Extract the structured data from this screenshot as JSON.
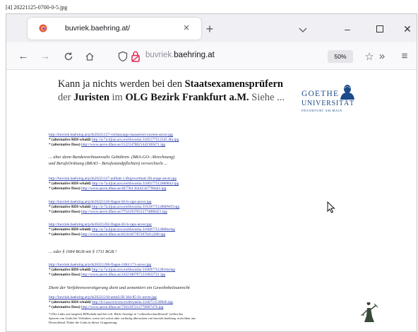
{
  "file_label": "[4] 20221125-0700-0-5.jpg",
  "browser": {
    "tab_title": "buvriek.baehring.at/",
    "url_prefix": "buvriek.",
    "url_host": "baehring.at",
    "zoom": "50%",
    "icons": {
      "favicon": "firefox-favicon",
      "back": "back-arrow-icon",
      "forward": "forward-arrow-icon",
      "reload": "reload-icon",
      "home": "home-icon",
      "shield": "tracking-shield-icon",
      "lock": "site-lock-icon",
      "star": "bookmark-star-icon",
      "overflow": "chevron-double-right-icon",
      "menu": "hamburger-menu-icon"
    },
    "accent": "#e22850"
  },
  "page": {
    "hero_pre": "Kann ja nichts werden bei den ",
    "hero_bold1": "Staatsexamensprüfern",
    "hero_l2_pre": "der ",
    "hero_bold2": "Juristen",
    "hero_l2_mid": " im ",
    "hero_bold3": "OLG Bezirk Frankfurt a.M.",
    "hero_l2_post": " Siehe ...",
    "logo": {
      "line1": "GOETHE",
      "line2": "UNIVERSITÄT",
      "line3": "FRANKFURT AM MAIN",
      "color": "#1c4a8a"
    },
    "link_groups": [
      {
        "url": "http://buvriek.baehring.at/p/bi20221127-verfassungs-masseriert-zwelen-anver.jpg",
        "lines": [
          {
            "label": "* (alternative RDI-wbald)",
            "url": "http://a-7a.tijian.avu.ewbhwosha 3165177512345 dfa.ipg"
          },
          {
            "label": "* (alternative Dass)",
            "url": "http://www.aavre.dfass.se/21223478021442100471 ipg"
          }
        ]
      },
      {
        "url": "http://buvriek.baehring.at/p/bi20221127-aufbatt-1.iftrgrwortbad-2Ib.erage-anver.jpg",
        "lines": [
          {
            "label": "* (alternative RDI-wbald)",
            "url": "http://a-7a.tijian.avu.ewbhwosha 3160177512680843 ipg"
          },
          {
            "label": "* (alternative Dass)",
            "url": "http://www.aavre.dfass.se/407784 36441567796443 ipg"
          }
        ]
      },
      {
        "url": "http://buvriek.baehring.at/p/bi20221126-flagen-83-b-raps-anver.ipg",
        "lines": [
          {
            "label": "* (alternative RDI-wbald)",
            "url": "http://a-7a.tijian.avu.ewbhwosha 3161077512808WD.ipg"
          },
          {
            "label": "* (alternative Dass)",
            "url": "http://www.aavre.dfass.se/775419370212774880421 ipg"
          }
        ]
      },
      {
        "url": "http://buvriek.baehring.at/p/bi20221202-flagen-83-b-raps-anver.jpg",
        "lines": [
          {
            "label": "* (alternative RDI-wbald)",
            "url": "http://a-7a.tijian.avu.ewbhwosha 3160677512808urlag"
          },
          {
            "label": "* (alternative Dass)",
            "url": "http://www.aavre.dfass.se/85181877872070212200 ipg"
          }
        ]
      },
      {
        "url": "http://buvriek.baehring.at/p/bi20221206-flagen-2484 171-anver.jpg",
        "lines": [
          {
            "label": "* (alternative RDI-wbald)",
            "url": "http://a-7a.tijian.avu.ewbhwosha 3160977512816urlag"
          },
          {
            "label": "* (alternative Dass)",
            "url": "http://www.aavre.dfass.se/24221807071216022721 ipg"
          }
        ]
      }
    ],
    "note1_a": "... aber dann Bundesrechtsanwalts Gebühren- (BRA-GO- Abrechnung)",
    "note1_b": "und BerufsOrdnung (BRAO - Berufsstandpflichten) verwechseln ...",
    "note2": "... oder § 1684 BGB mit § 1711 BGB !",
    "note3": "Dient der Verfahrensverzögerung dient und zementiert ein Gewohnheitsunrecht",
    "final_group": {
      "url": "http://buvriek.baehring.at/p/bi20221210-amtsI.JH 384-85-Sc-anver.jpg",
      "lines": [
        {
          "label": "* (alternative RDI-wbald)",
          "url": "http://b-l.aa.ewwvee.ewbhwasha 31607511309sE.ipg"
        },
        {
          "label": "* (alternative Dass)",
          "url": "http://www.aavre.dfass.se/7501307212778907476.ipg"
        }
      ]
    },
    "footnote_1": "*) Die Links auf (ungern) RDIwbald und bei evtl. Blick-Anzeige in \"vollem/hochauflösend\" (selbst das",
    "footnote_2": "Sperren von Links bei Verlinken, wenn sie) sofort aber vorläufig übersetzen von buvriek.baehring. erreichbar aus",
    "footnote_3": "Deutschland. Daher die Links in dieser Gruppierung."
  }
}
